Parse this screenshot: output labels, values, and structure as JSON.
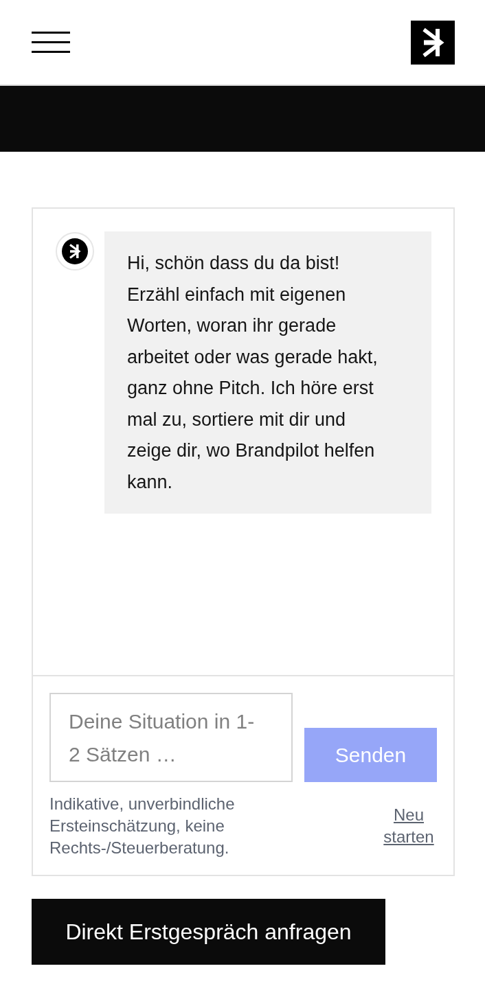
{
  "chat": {
    "messages": [
      {
        "kind": "bot",
        "text": "Hi, schön dass du da bist! Erzähl einfach mit eigenen Worten, woran ihr gerade arbeitet oder was gerade hakt, ganz ohne Pitch. Ich höre erst mal zu, sortiere mit dir und zeige dir, wo Brandpilot helfen kann."
      }
    ]
  },
  "composer": {
    "input": {
      "placeholder": "Deine Situation in 1-2 Sätzen …"
    },
    "send_button": {
      "label": "Senden",
      "disabled": true
    },
    "disclaimer": "Indikative, unverbindliche Ersteinschätzung, keine Rechts-/Steuerberatung.",
    "restart_link": "Neu starten"
  },
  "cta_button": {
    "label": "Direkt Erstgespräch anfragen"
  }
}
